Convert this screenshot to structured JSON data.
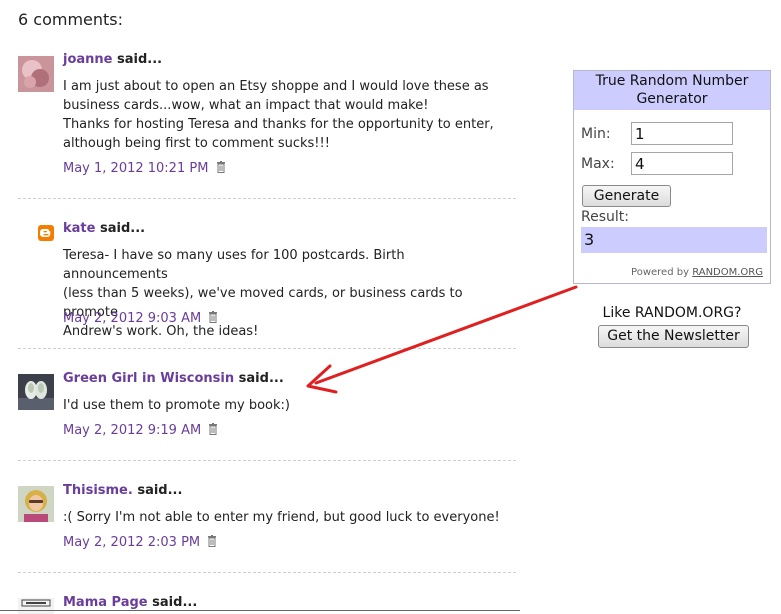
{
  "heading": "6 comments:",
  "comments": [
    {
      "author": "joanne",
      "said": "said...",
      "lines": [
        "I am just about to open an Etsy shoppe and I would love these as",
        "business cards...wow, what an impact that would make!",
        "Thanks for hosting Teresa and thanks for the opportunity to enter,",
        "although being first to comment sucks!!!"
      ],
      "date": "May 1, 2012 10:21 PM"
    },
    {
      "author": "kate",
      "said": "said...",
      "lines": [
        "Teresa- I have so many uses for 100 postcards. Birth announcements",
        "(less than 5 weeks), we've moved cards, or business cards to promote",
        "Andrew's work. Oh, the ideas!"
      ],
      "date": "May 2, 2012 9:03 AM"
    },
    {
      "author": "Green Girl in Wisconsin",
      "said": "said...",
      "lines": [
        "I'd use them to promote my book:)"
      ],
      "date": "May 2, 2012 9:19 AM"
    },
    {
      "author": "Thisisme.",
      "said": "said...",
      "lines": [
        ":( Sorry I'm not able to enter my friend, but good luck to everyone!"
      ],
      "date": "May 2, 2012 2:03 PM"
    },
    {
      "author": "Mama Page",
      "said": "said..."
    }
  ],
  "rng": {
    "title_line1": "True Random Number",
    "title_line2": "Generator",
    "min_label": "Min:",
    "min_value": "1",
    "max_label": "Max:",
    "max_value": "4",
    "generate_label": "Generate",
    "result_label": "Result:",
    "result_value": "3",
    "powered_prefix": "Powered by",
    "powered_link": "RANDOM.ORG"
  },
  "like_text": "Like RANDOM.ORG?",
  "newsletter_label": "Get the Newsletter",
  "colors": {
    "link": "#6a3d9a",
    "panel": "#ccccff",
    "arrow": "#e02020"
  }
}
